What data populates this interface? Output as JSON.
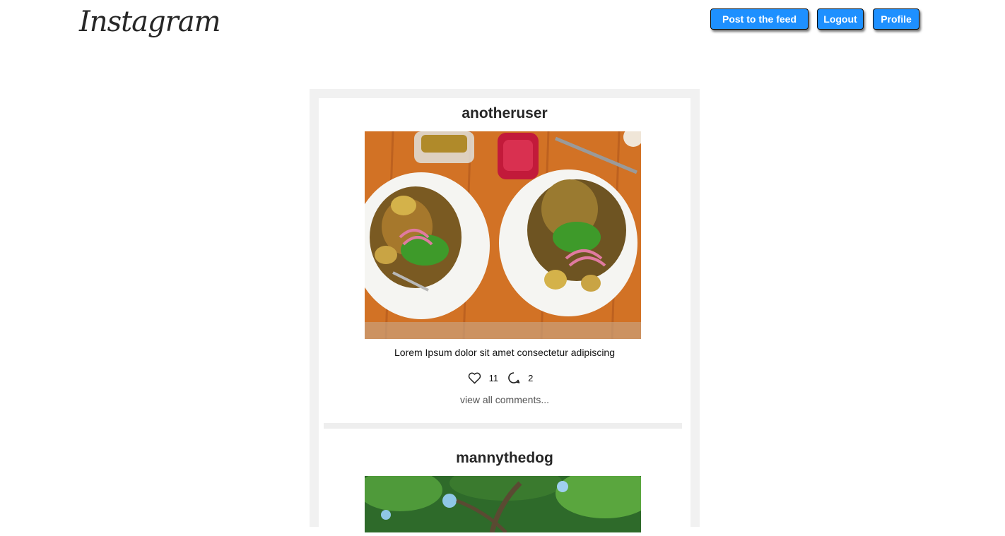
{
  "header": {
    "logo_text": "Instagram",
    "buttons": {
      "post": "Post to the feed",
      "logout": "Logout",
      "profile": "Profile"
    },
    "button_color": "#1e90ff"
  },
  "posts": [
    {
      "username": "anotheruser",
      "image_icon": "food-photo",
      "caption": "Lorem Ipsum dolor sit amet consectetur adipiscing",
      "likes": "11",
      "comments": "2",
      "view_comments": "view all comments..."
    },
    {
      "username": "mannythedog",
      "image_icon": "tree-photo"
    }
  ]
}
